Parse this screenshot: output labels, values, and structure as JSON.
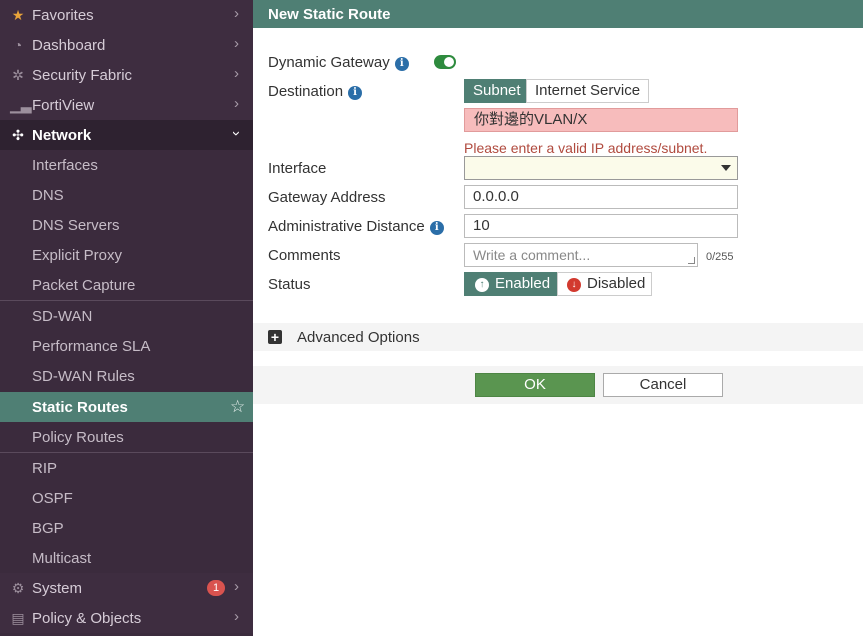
{
  "sidebar": {
    "top_items": [
      {
        "label": "Favorites",
        "icon": "star-icon"
      },
      {
        "label": "Dashboard",
        "icon": "dashboard-icon"
      },
      {
        "label": "Security Fabric",
        "icon": "fabric-icon"
      },
      {
        "label": "FortiView",
        "icon": "chart-icon"
      }
    ],
    "network": {
      "label": "Network",
      "icon": "network-icon"
    },
    "network_items": [
      "Interfaces",
      "DNS",
      "DNS Servers",
      "Explicit Proxy",
      "Packet Capture",
      "SD-WAN",
      "Performance SLA",
      "SD-WAN Rules",
      "Static Routes",
      "Policy Routes",
      "RIP",
      "OSPF",
      "BGP",
      "Multicast"
    ],
    "system": {
      "label": "System",
      "icon": "gear-icon",
      "badge": "1"
    },
    "policy": {
      "label": "Policy & Objects",
      "icon": "policy-icon"
    },
    "colors": {
      "background": "#3b2b3d",
      "active": "#4f7f74"
    }
  },
  "form": {
    "title": "New Static Route",
    "dynamic_gateway": {
      "label": "Dynamic Gateway",
      "enabled": true
    },
    "destination": {
      "label": "Destination",
      "segments": [
        "Subnet",
        "Internet Service"
      ],
      "selected": "Subnet",
      "value": "你對邊的VLAN/X",
      "error": "Please enter a valid IP address/subnet."
    },
    "interface": {
      "label": "Interface",
      "value": ""
    },
    "gateway": {
      "label": "Gateway Address",
      "value": "0.0.0.0"
    },
    "distance": {
      "label": "Administrative Distance",
      "value": "10"
    },
    "comments": {
      "label": "Comments",
      "placeholder": "Write a comment...",
      "counter": "0/255"
    },
    "status": {
      "label": "Status",
      "enabled_label": "Enabled",
      "disabled_label": "Disabled",
      "selected": "Enabled"
    },
    "advanced": {
      "label": "Advanced Options"
    },
    "ok_label": "OK",
    "cancel_label": "Cancel"
  }
}
